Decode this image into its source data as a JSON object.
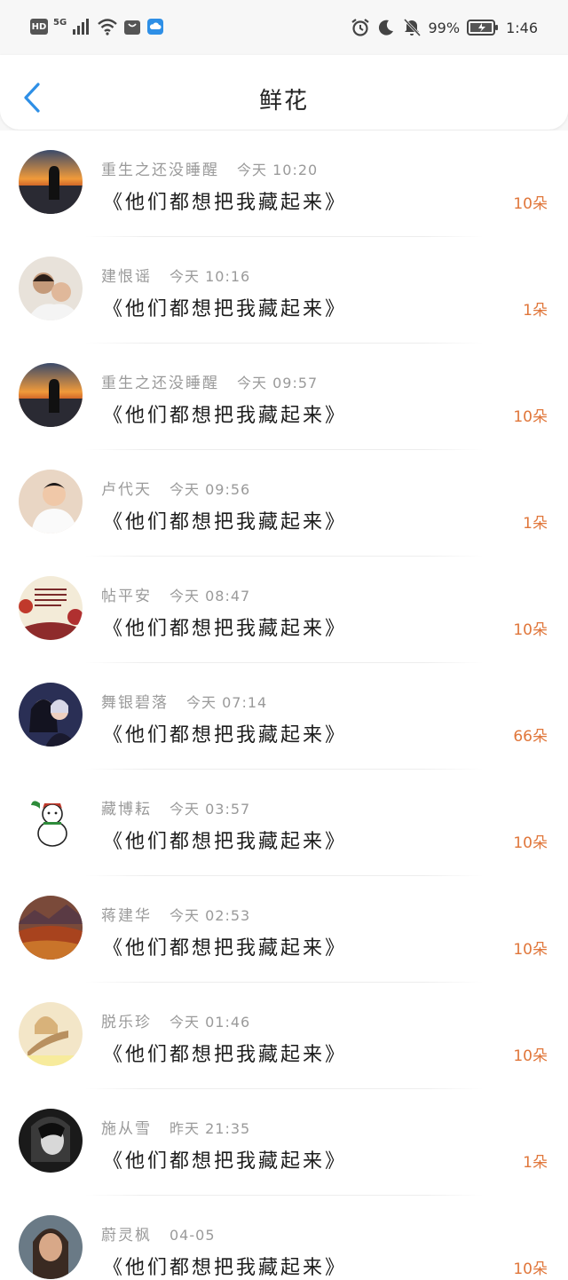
{
  "statusbar": {
    "hd": "HD",
    "network": "5G",
    "battery": "99%",
    "time": "1:46"
  },
  "header": {
    "title": "鲜花",
    "back_icon": "chevron-left-icon"
  },
  "colors": {
    "accent": "#2e8fe6",
    "amount": "#e0763a",
    "meta": "#9a9a9a"
  },
  "records": [
    {
      "name": "重生之还没睡醒",
      "time": "今天 10:20",
      "book": "《他们都想把我藏起来》",
      "amount": "10朵",
      "avatar": "sunset-silhouette"
    },
    {
      "name": "建恨谣",
      "time": "今天 10:16",
      "book": "《他们都想把我藏起来》",
      "amount": "1朵",
      "avatar": "couple-photo"
    },
    {
      "name": "重生之还没睡醒",
      "time": "今天 09:57",
      "book": "《他们都想把我藏起来》",
      "amount": "10朵",
      "avatar": "sunset-silhouette"
    },
    {
      "name": "卢代天",
      "time": "今天 09:56",
      "book": "《他们都想把我藏起来》",
      "amount": "1朵",
      "avatar": "young-man"
    },
    {
      "name": "帖平安",
      "time": "今天 08:47",
      "book": "《他们都想把我藏起来》",
      "amount": "10朵",
      "avatar": "floral-text-card"
    },
    {
      "name": "舞银碧落",
      "time": "今天 07:14",
      "book": "《他们都想把我藏起来》",
      "amount": "66朵",
      "avatar": "anime-couple"
    },
    {
      "name": "藏博耘",
      "time": "今天 03:57",
      "book": "《他们都想把我藏起来》",
      "amount": "10朵",
      "avatar": "cartoon-snowman"
    },
    {
      "name": "蒋建华",
      "time": "今天 02:53",
      "book": "《他们都想把我藏起来》",
      "amount": "10朵",
      "avatar": "autumn-landscape"
    },
    {
      "name": "脱乐珍",
      "time": "今天 01:46",
      "book": "《他们都想把我藏起来》",
      "amount": "10朵",
      "avatar": "anime-girl-card"
    },
    {
      "name": "施从雪",
      "time": "昨天 21:35",
      "book": "《他们都想把我藏起来》",
      "amount": "1朵",
      "avatar": "monochrome-portrait"
    },
    {
      "name": "蔚灵枫",
      "time": "04-05",
      "book": "《他们都想把我藏起来》",
      "amount": "10朵",
      "avatar": "woman-portrait"
    }
  ]
}
